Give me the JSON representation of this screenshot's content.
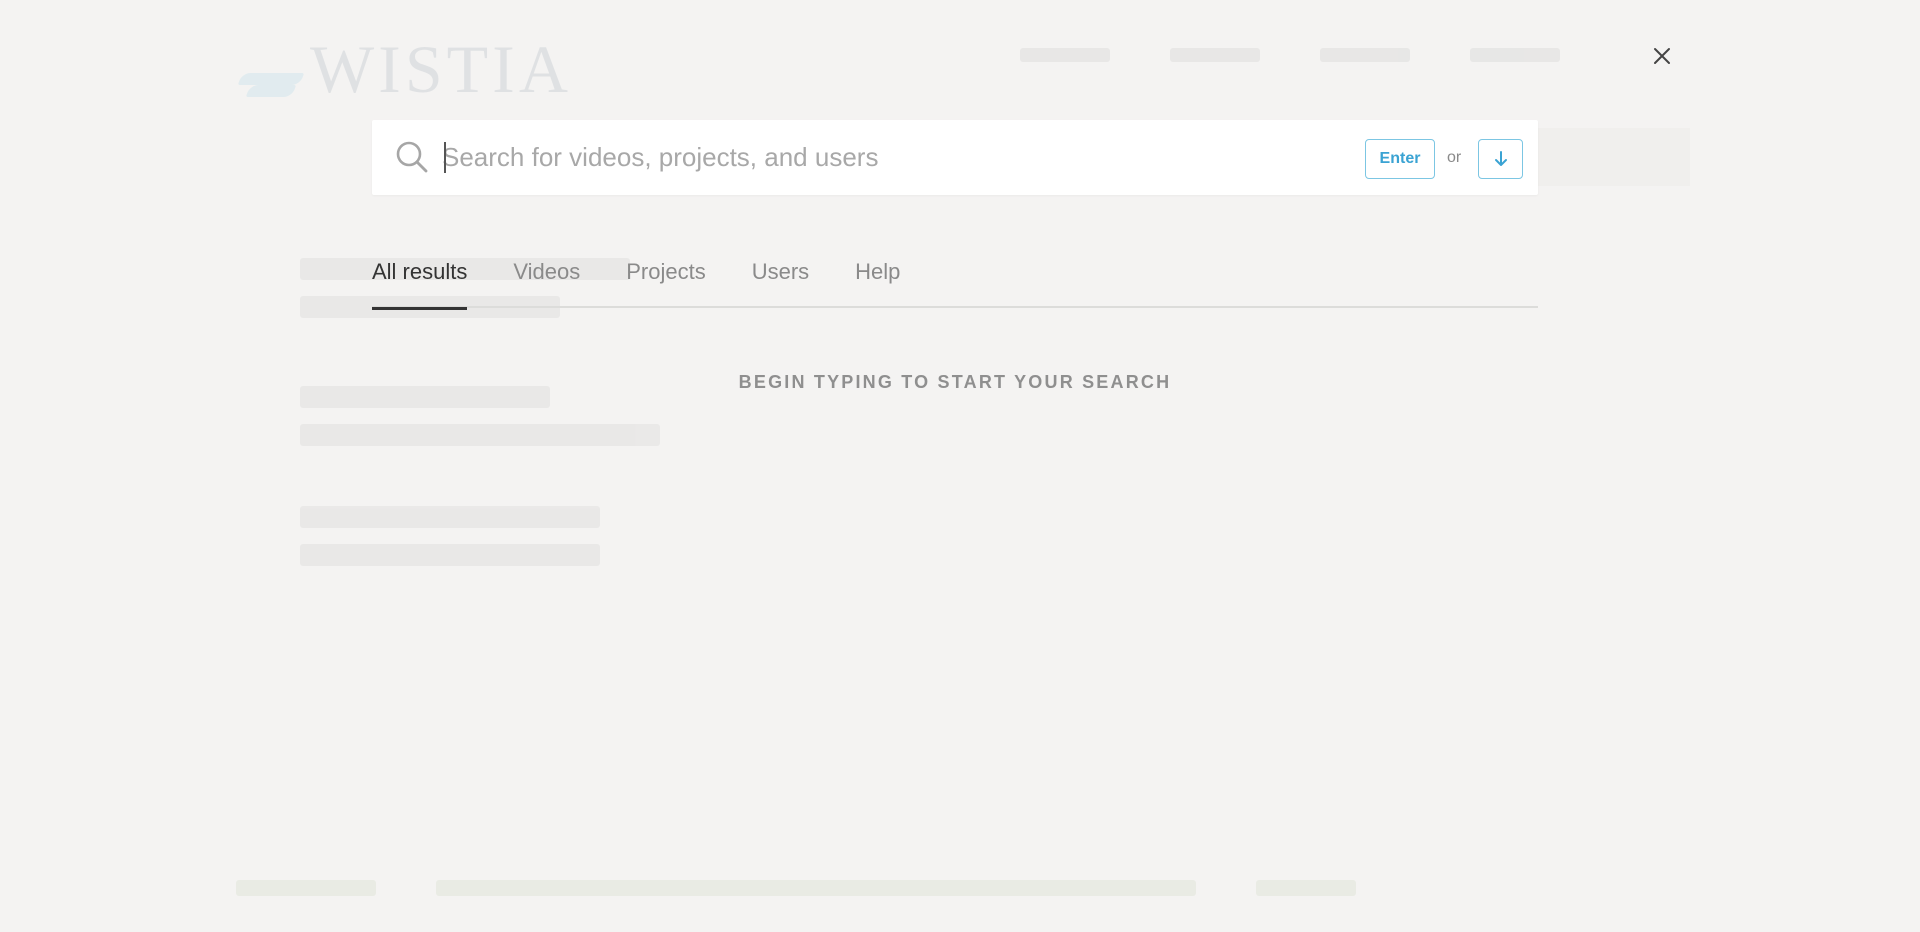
{
  "search": {
    "placeholder": "Search for videos, projects, and users",
    "enter_label": "Enter",
    "or_label": "or",
    "arrow_key": "down-arrow-icon"
  },
  "tabs": [
    {
      "label": "All results",
      "active": true
    },
    {
      "label": "Videos",
      "active": false
    },
    {
      "label": "Projects",
      "active": false
    },
    {
      "label": "Users",
      "active": false
    },
    {
      "label": "Help",
      "active": false
    }
  ],
  "hint": "BEGIN TYPING TO START YOUR SEARCH",
  "background": {
    "logo_text": "WISTIA"
  },
  "colors": {
    "accent": "#3aa3d3",
    "background": "#f4f3f2",
    "tab_active": "#333333",
    "tab_inactive": "#8a8a8a"
  },
  "icons": {
    "search": "search-icon",
    "close": "close-icon",
    "down": "down-arrow-icon"
  }
}
